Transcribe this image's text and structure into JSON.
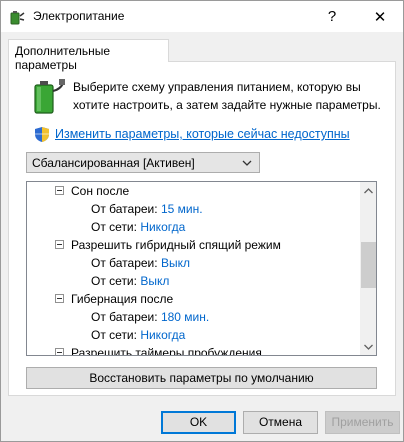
{
  "window": {
    "title": "Электропитание",
    "help_label": "?",
    "close_label": "✕"
  },
  "tab": {
    "label": "Дополнительные параметры"
  },
  "description": "Выберите схему управления питанием, которую вы хотите настроить, а затем задайте нужные параметры.",
  "change_link": "Изменить параметры, которые сейчас недоступны",
  "plan_select": {
    "value": "Сбалансированная [Активен]"
  },
  "tree": {
    "items": [
      {
        "label": "Сон после",
        "type": "group"
      },
      {
        "label": "От батареи:",
        "value": "15 мин.",
        "type": "setting"
      },
      {
        "label": "От сети:",
        "value": "Никогда",
        "type": "setting"
      },
      {
        "label": "Разрешить гибридный спящий режим",
        "type": "group"
      },
      {
        "label": "От батареи:",
        "value": "Выкл",
        "type": "setting"
      },
      {
        "label": "От сети:",
        "value": "Выкл",
        "type": "setting"
      },
      {
        "label": "Гибернация после",
        "type": "group"
      },
      {
        "label": "От батареи:",
        "value": "180 мин.",
        "type": "setting"
      },
      {
        "label": "От сети:",
        "value": "Никогда",
        "type": "setting"
      },
      {
        "label": "Разрешить таймеры пробуждения",
        "type": "group"
      }
    ]
  },
  "restore_button": "Восстановить параметры по умолчанию",
  "buttons": {
    "ok": "OK",
    "cancel": "Отмена",
    "apply": "Применить"
  },
  "colors": {
    "link": "#0066cc",
    "value": "#0066cc",
    "ok_border": "#0078d7"
  },
  "icons": [
    "power-options-icon",
    "battery-plug-icon",
    "uac-shield-icon",
    "chevron-down-icon",
    "collapse-icon"
  ]
}
